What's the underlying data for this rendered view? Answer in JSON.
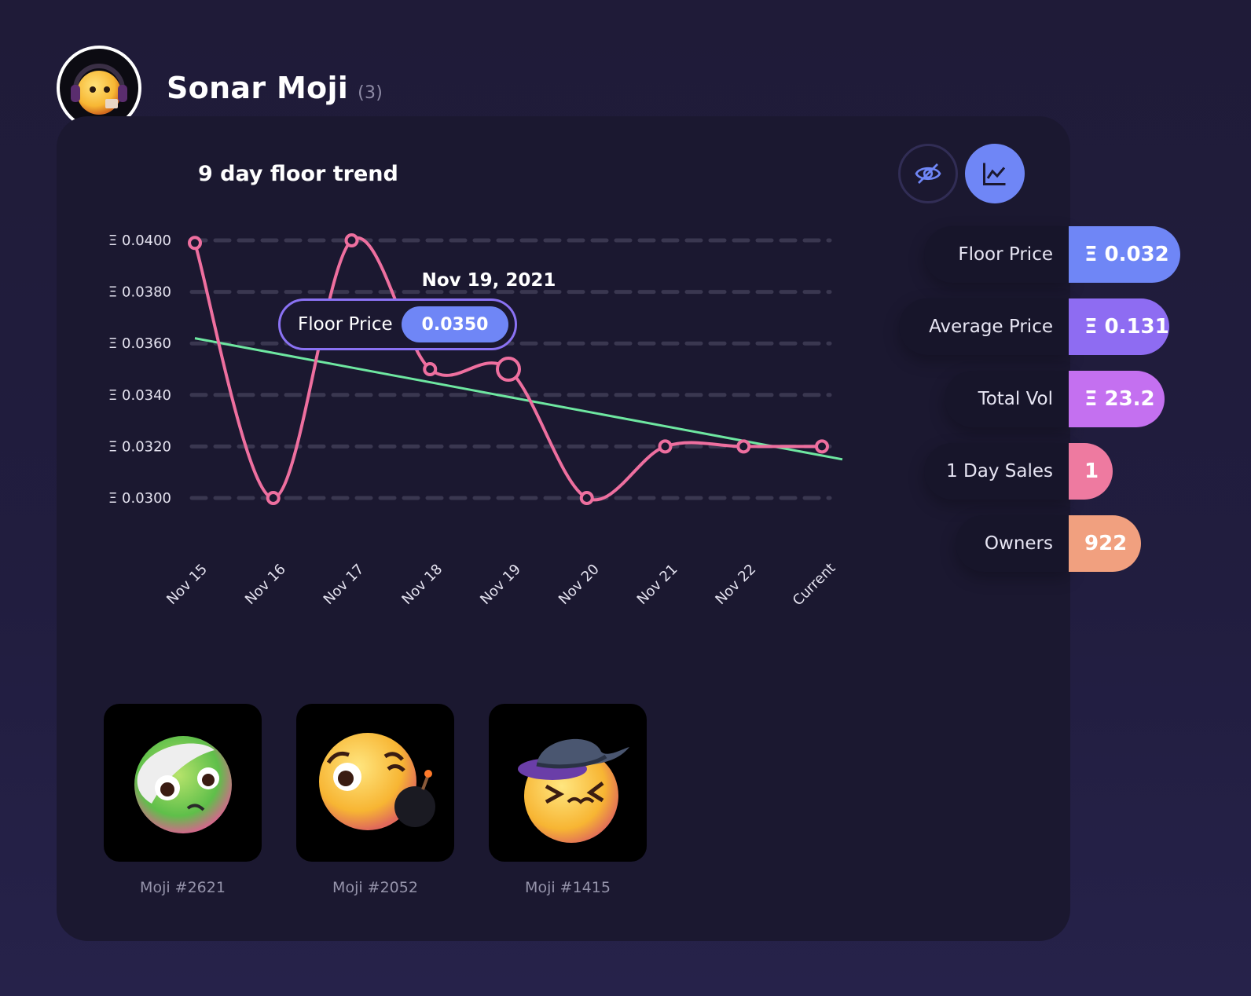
{
  "collection": {
    "name": "Sonar Moji",
    "count": "(3)"
  },
  "chart_title": "9 day floor trend",
  "buttons": {
    "hide": "eye-slash-icon",
    "chart": "line-chart-icon"
  },
  "tooltip": {
    "date": "Nov 19, 2021",
    "label": "Floor Price",
    "value": "0.0350"
  },
  "chart_data": {
    "type": "line",
    "categories": [
      "Nov 15",
      "Nov 16",
      "Nov 17",
      "Nov 18",
      "Nov 19",
      "Nov 20",
      "Nov 21",
      "Nov 22",
      "Current"
    ],
    "values": [
      0.0399,
      0.03,
      0.04,
      0.035,
      0.035,
      0.03,
      0.032,
      0.032,
      0.032
    ],
    "trendline": [
      0.0362,
      0.0315
    ],
    "y_ticks": [
      "Ξ 0.0400",
      "Ξ 0.0380",
      "Ξ 0.0360",
      "Ξ 0.0340",
      "Ξ 0.0320",
      "Ξ 0.0300"
    ],
    "ylim": [
      0.03,
      0.04
    ],
    "highlight_index": 4,
    "grid": true,
    "colors": {
      "line": "#ee6f9f",
      "trend": "#6ee7a1",
      "grid": "#3a3750"
    }
  },
  "stats": [
    {
      "label": "Floor Price",
      "value": "Ξ 0.032",
      "color": "#6f86f6"
    },
    {
      "label": "Average Price",
      "value": "Ξ 0.131",
      "color": "#8e6cf2"
    },
    {
      "label": "Total Vol",
      "value": "Ξ 23.2",
      "color": "#c470f0"
    },
    {
      "label": "1 Day Sales",
      "value": "1",
      "color": "#ee7aa0"
    },
    {
      "label": "Owners",
      "value": "922",
      "color": "#f1a07f"
    }
  ],
  "nfts": [
    {
      "name": "Moji #2621"
    },
    {
      "name": "Moji #2052"
    },
    {
      "name": "Moji #1415"
    }
  ]
}
